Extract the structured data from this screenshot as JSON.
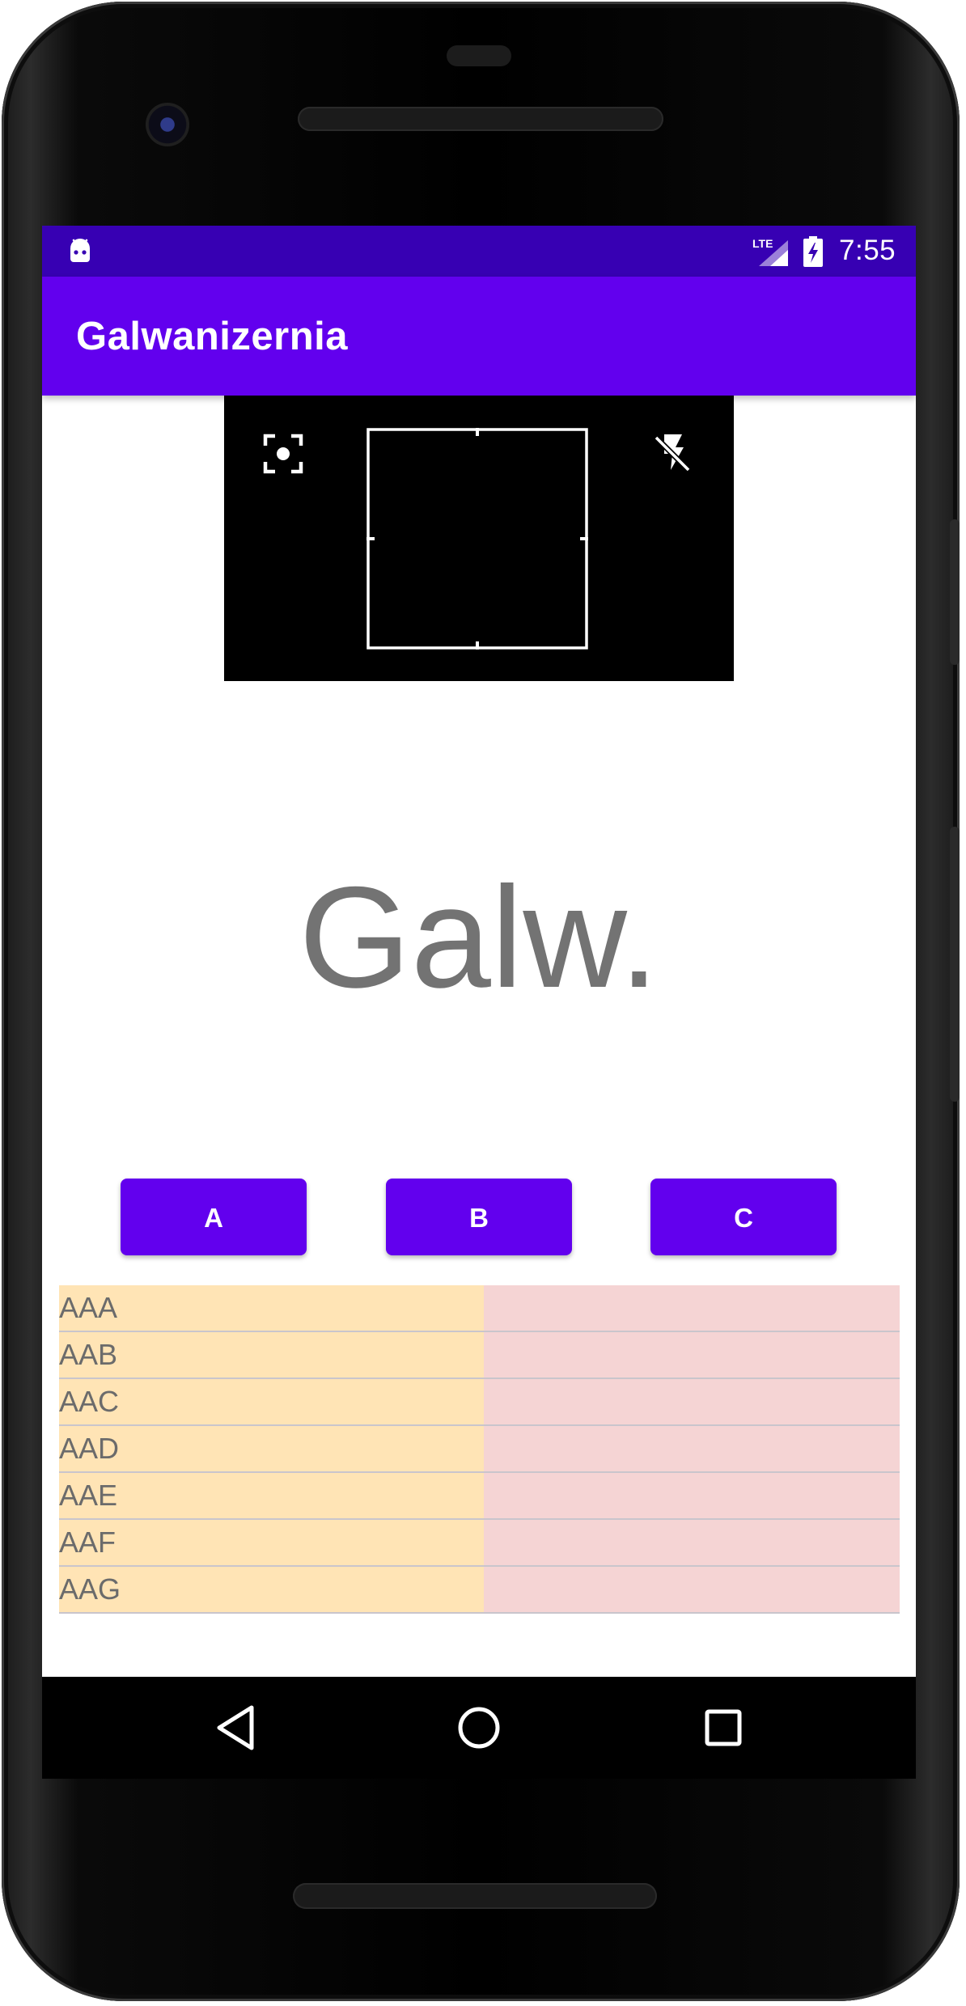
{
  "status_bar": {
    "time": "7:55",
    "network": "LTE",
    "icons": [
      "android-debug-icon",
      "lte-signal-icon",
      "battery-charging-icon"
    ]
  },
  "app_bar": {
    "title": "Galwanizernia"
  },
  "scanner": {
    "icons": [
      "focus-icon",
      "flash-off-icon"
    ]
  },
  "main": {
    "big_label": "Galw."
  },
  "buttons": {
    "a": "A",
    "b": "B",
    "c": "C"
  },
  "table": {
    "rows": [
      {
        "left": "AAA",
        "right": ""
      },
      {
        "left": "AAB",
        "right": ""
      },
      {
        "left": "AAC",
        "right": ""
      },
      {
        "left": "AAD",
        "right": ""
      },
      {
        "left": "AAE",
        "right": ""
      },
      {
        "left": "AAF",
        "right": ""
      },
      {
        "left": "AAG",
        "right": ""
      }
    ]
  },
  "nav_bar": {
    "icons": [
      "back-icon",
      "home-icon",
      "recents-icon"
    ]
  },
  "colors": {
    "status_bar": "#3700b3",
    "app_bar": "#6200ee",
    "button": "#6200ee",
    "table_left": "#ffe4b5",
    "table_right": "#f5d4d4",
    "big_label": "#737373"
  }
}
